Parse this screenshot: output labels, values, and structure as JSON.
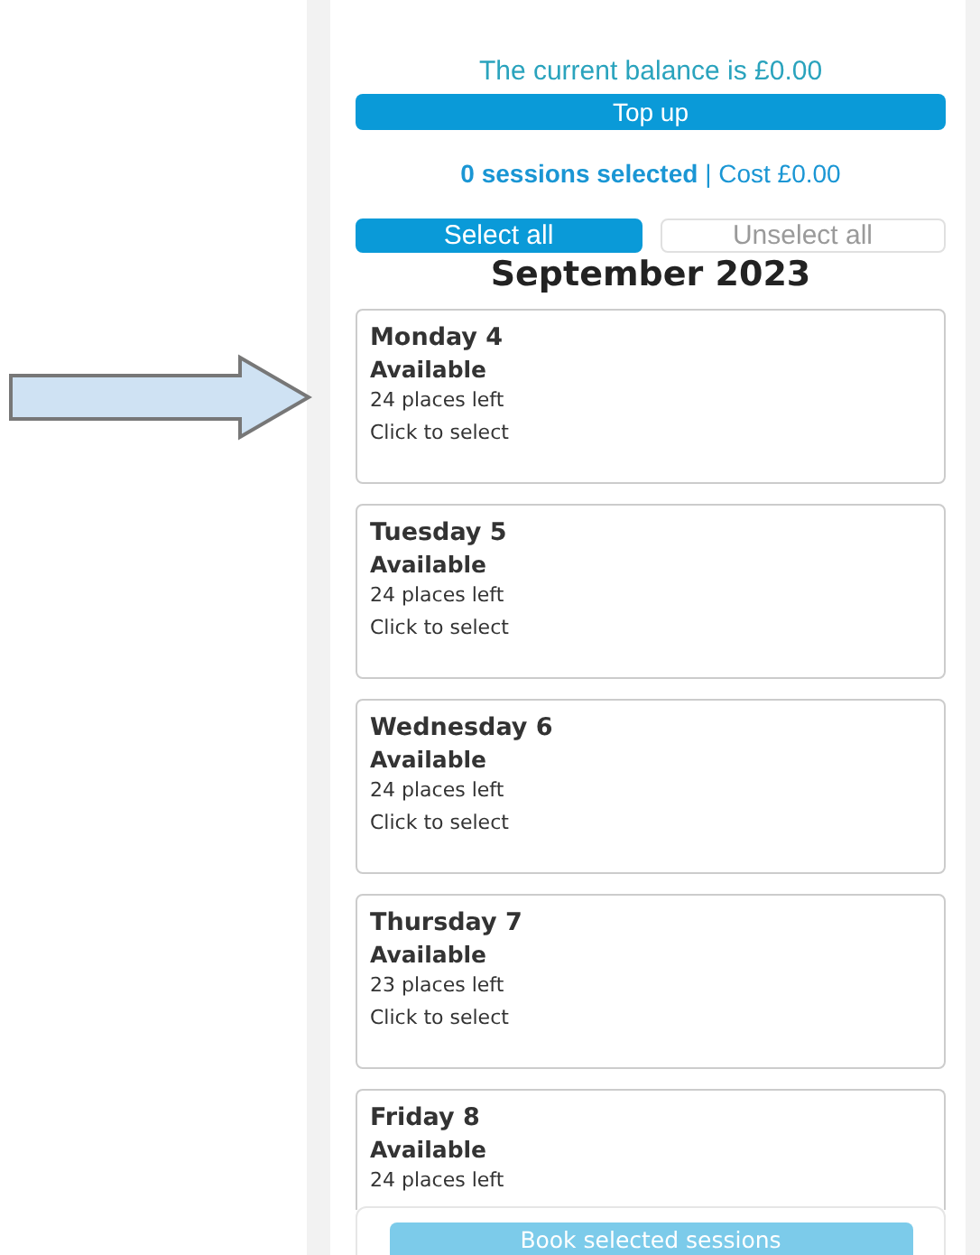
{
  "balance": {
    "text": "The current balance is £0.00"
  },
  "top_up": {
    "label": "Top up"
  },
  "summary": {
    "text": "**0 sessions selected** | Cost £0.00"
  },
  "selection_buttons": [
    {
      "label": "Select all",
      "selected": true
    },
    {
      "label": "Unselect all",
      "selected": false
    }
  ],
  "month": "September 2023",
  "sessions": [
    {
      "day": "Monday 4",
      "status": "Available",
      "places": "24 places left",
      "action": "Click to select"
    },
    {
      "day": "Tuesday 5",
      "status": "Available",
      "places": "24 places left",
      "action": "Click to select"
    },
    {
      "day": "Wednesday 6",
      "status": "Available",
      "places": "24 places left",
      "action": "Click to select"
    },
    {
      "day": "Thursday 7",
      "status": "Available",
      "places": "23 places left",
      "action": "Click to select"
    },
    {
      "day": "Friday 8",
      "status": "Available",
      "places": "24 places left"
    }
  ],
  "book_button": {
    "label": "Book selected sessions",
    "disabled": true
  }
}
